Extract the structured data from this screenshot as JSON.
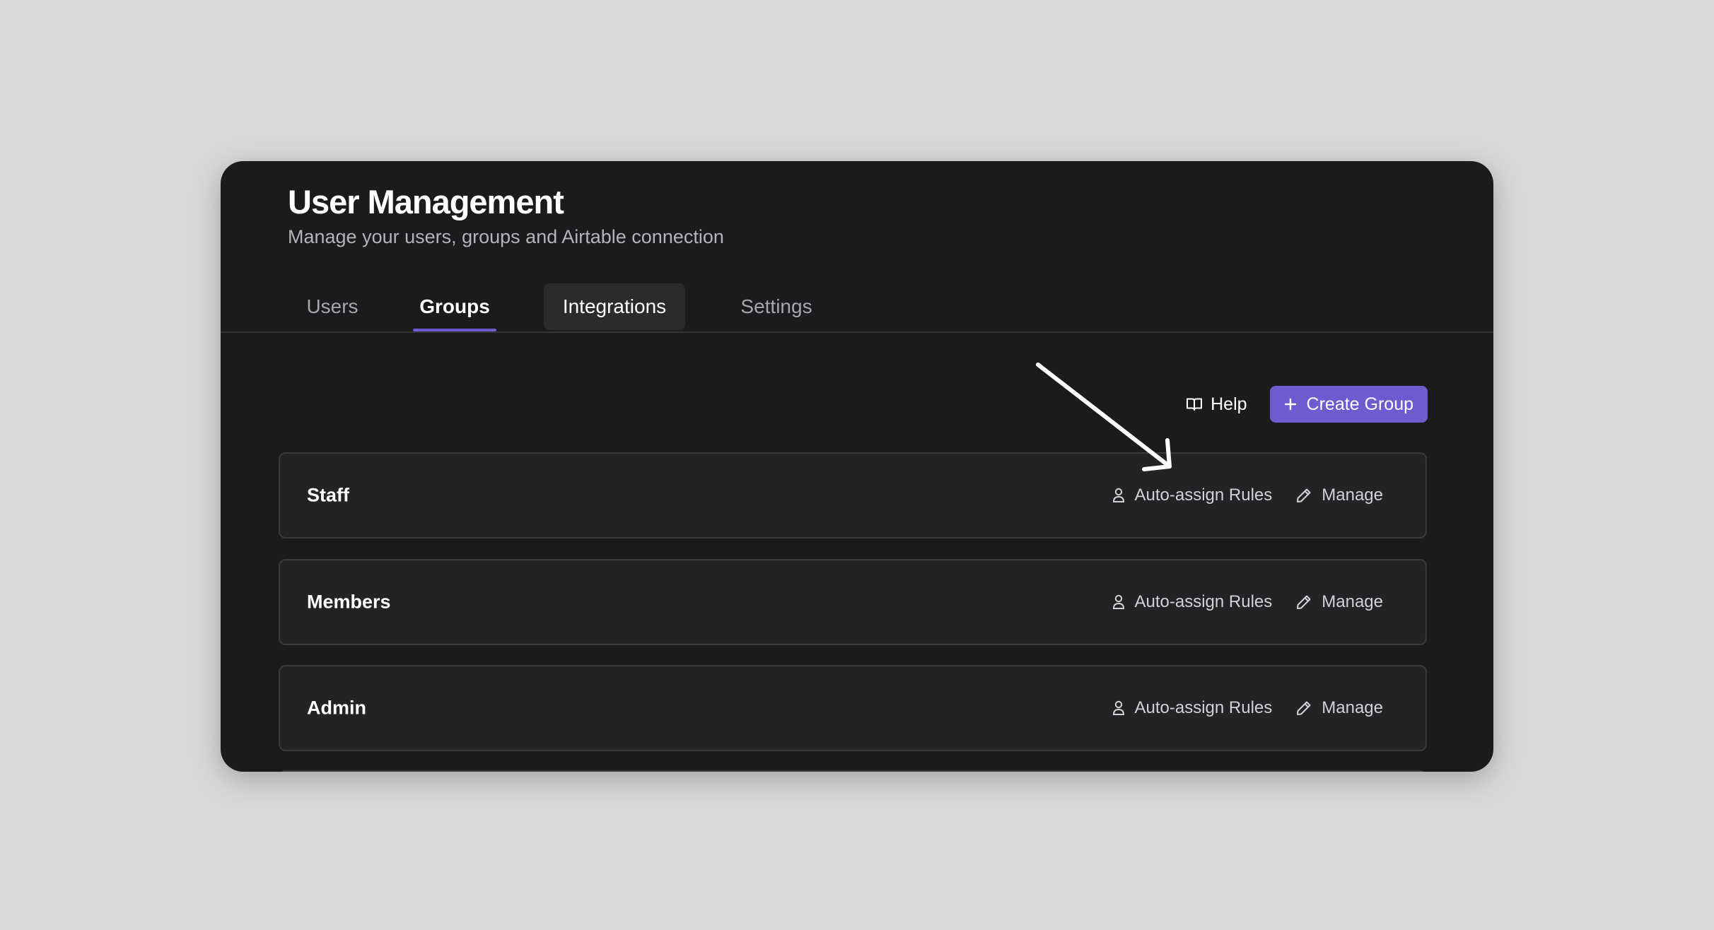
{
  "page": {
    "title": "User Management",
    "subtitle": "Manage your users, groups and Airtable connection"
  },
  "tabs": [
    {
      "label": "Users",
      "active": false
    },
    {
      "label": "Groups",
      "active": true
    },
    {
      "label": "Integrations",
      "active": false,
      "hovered": true
    },
    {
      "label": "Settings",
      "active": false
    }
  ],
  "toolbar": {
    "help_label": "Help",
    "create_label": "Create Group"
  },
  "groups": [
    {
      "name": "Staff",
      "rules_label": "Auto-assign Rules",
      "manage_label": "Manage"
    },
    {
      "name": "Members",
      "rules_label": "Auto-assign Rules",
      "manage_label": "Manage"
    },
    {
      "name": "Admin",
      "rules_label": "Auto-assign Rules",
      "manage_label": "Manage"
    }
  ],
  "colors": {
    "accent": "#6d5bd0",
    "panel_bg": "#1b1b1d",
    "row_bg": "#232325",
    "page_bg": "#d9d9d9"
  },
  "icons": {
    "help": "book-open-icon",
    "create": "plus-icon",
    "rules": "user-icon",
    "manage": "pencil-icon"
  }
}
